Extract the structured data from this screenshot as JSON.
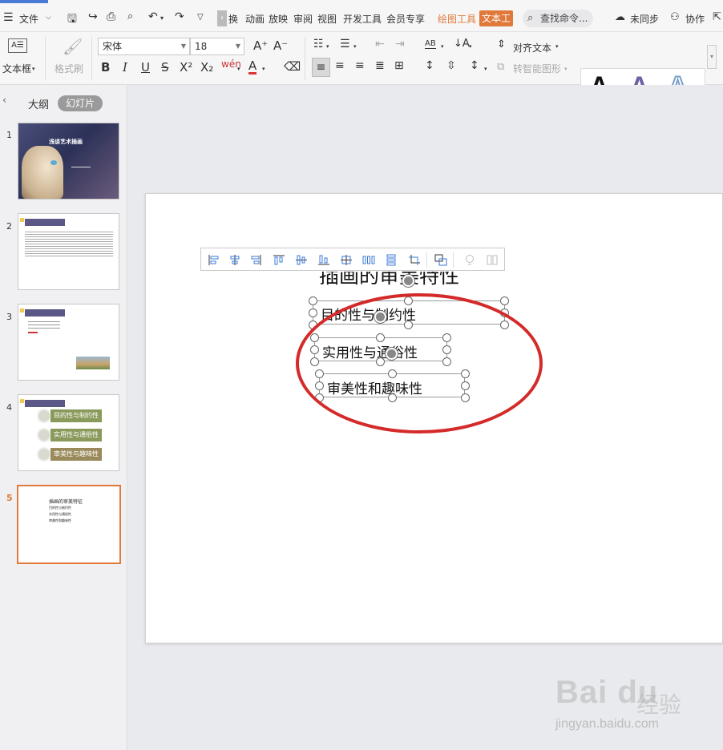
{
  "menu": {
    "file": "文件",
    "tabs": [
      "换",
      "动画",
      "放映",
      "审阅",
      "视图",
      "开发工具",
      "会员专享"
    ],
    "drawing_tools": "绘图工具",
    "text_tools": "文本工",
    "search": "查找命令...",
    "sync": "未同步",
    "collab": "协作"
  },
  "ribbon": {
    "textbox": "文本框",
    "format_painter": "格式刷",
    "font_name": "宋体",
    "font_size": "18",
    "align_text": "对齐文本",
    "smart_shape": "转智能图形",
    "bold": "B",
    "italic": "I",
    "underline": "U",
    "strike": "S",
    "style_letter": "A",
    "colors": {
      "accent": "#e0793a",
      "style2": "#6b63a6",
      "style3": "#7aa0c8"
    }
  },
  "panel": {
    "outline": "大纲",
    "slides": "幻灯片",
    "numbers": [
      "1",
      "2",
      "3",
      "4",
      "5"
    ],
    "thumb1_title": "浅谈艺术插画",
    "thumb4_items": [
      "目的性与制约性",
      "实用性与通俗性",
      "审美性与趣味性"
    ],
    "thumb5_title": "插画的审美特征"
  },
  "slide": {
    "title": "插画的审美特性",
    "items": [
      "目的性与制约性",
      "实用性与通俗性",
      "审美性和趣味性"
    ]
  },
  "watermark": {
    "brand": "Bai du",
    "cn": "经验",
    "url": "jingyan.baidu.com"
  }
}
